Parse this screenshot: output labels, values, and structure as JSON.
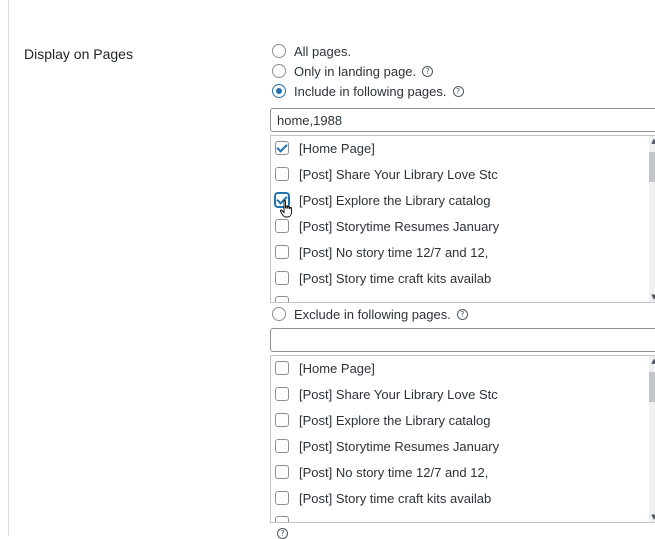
{
  "section_label": "Display on Pages",
  "options": {
    "all_pages": "All pages.",
    "only_landing": "Only in landing page.",
    "include_following": "Include in following pages.",
    "exclude_following": "Exclude in following pages."
  },
  "help_icon": "?",
  "include": {
    "field_value": "home,1988",
    "items": [
      {
        "label": "[Home Page]",
        "checked": true
      },
      {
        "label": "[Post] Share Your Library Love Stc",
        "checked": false
      },
      {
        "label": "[Post] Explore the Library catalog",
        "checked": true
      },
      {
        "label": "[Post] Storytime Resumes January",
        "checked": false
      },
      {
        "label": "[Post] No story time 12/7 and 12,",
        "checked": false
      },
      {
        "label": "[Post] Story time craft kits availab",
        "checked": false
      }
    ]
  },
  "exclude": {
    "field_value": "",
    "items": [
      {
        "label": "[Home Page]",
        "checked": false
      },
      {
        "label": "[Post] Share Your Library Love Stc",
        "checked": false
      },
      {
        "label": "[Post] Explore the Library catalog",
        "checked": false
      },
      {
        "label": "[Post] Storytime Resumes January",
        "checked": false
      },
      {
        "label": "[Post] No story time 12/7 and 12,",
        "checked": false
      },
      {
        "label": "[Post] Story time craft kits availab",
        "checked": false
      }
    ]
  },
  "colors": {
    "accent": "#2271b1",
    "border": "#8c8f94"
  }
}
